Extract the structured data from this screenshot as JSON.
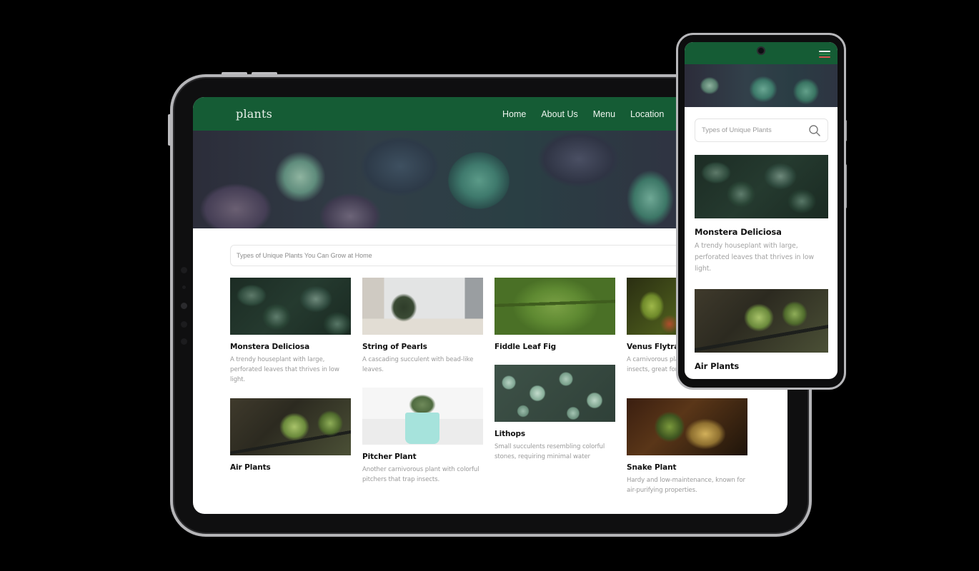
{
  "tablet": {
    "navbar": {
      "logo": "plants",
      "links": [
        "Home",
        "About Us",
        "Menu",
        "Location"
      ]
    },
    "search": {
      "placeholder": "Types of Unique Plants You Can Grow at Home"
    },
    "cards": [
      {
        "title": "Monstera Deliciosa",
        "description": "A trendy houseplant with large, perforated leaves that thrives in low light.",
        "image": "monstera-image"
      },
      {
        "title": "String of Pearls",
        "description": "A cascading succulent with bead-like leaves.",
        "image": "string-of-pearls-image"
      },
      {
        "title": "Fiddle Leaf Fig",
        "description": "",
        "image": "fiddle-leaf-fig-image"
      },
      {
        "title": "Venus Flytrap",
        "description": "A carnivorous plant that catches insects, great for Types of Unique Plants",
        "image": "venus-flytrap-image"
      },
      {
        "title": "Air Plants",
        "description": "",
        "image": "air-plants-image"
      },
      {
        "title": "Pitcher Plant",
        "description": "Another carnivorous plant with colorful pitchers that trap insects.",
        "image": "pitcher-plant-image"
      },
      {
        "title": "Lithops",
        "description": "Small succulents resembling colorful stones, requiring minimal water",
        "image": "lithops-image"
      },
      {
        "title": "Snake Plant",
        "description": "Hardy and low-maintenance, known for air-purifying properties.",
        "image": "snake-plant-image"
      }
    ]
  },
  "phone": {
    "menu_icon_colors": [
      "#ffffff",
      "#1f7a3d",
      "#d9534f"
    ],
    "search": {
      "placeholder": "Types of Unique Plants"
    },
    "cards": [
      {
        "title": "Monstera Deliciosa",
        "description": "A trendy houseplant with large, perforated leaves that thrives in low light."
      },
      {
        "title": "Air Plants",
        "description": ""
      }
    ]
  },
  "colors": {
    "brand_green": "#155c35",
    "page_bg": "#000000",
    "frame_silver": "#b5b5b8"
  }
}
